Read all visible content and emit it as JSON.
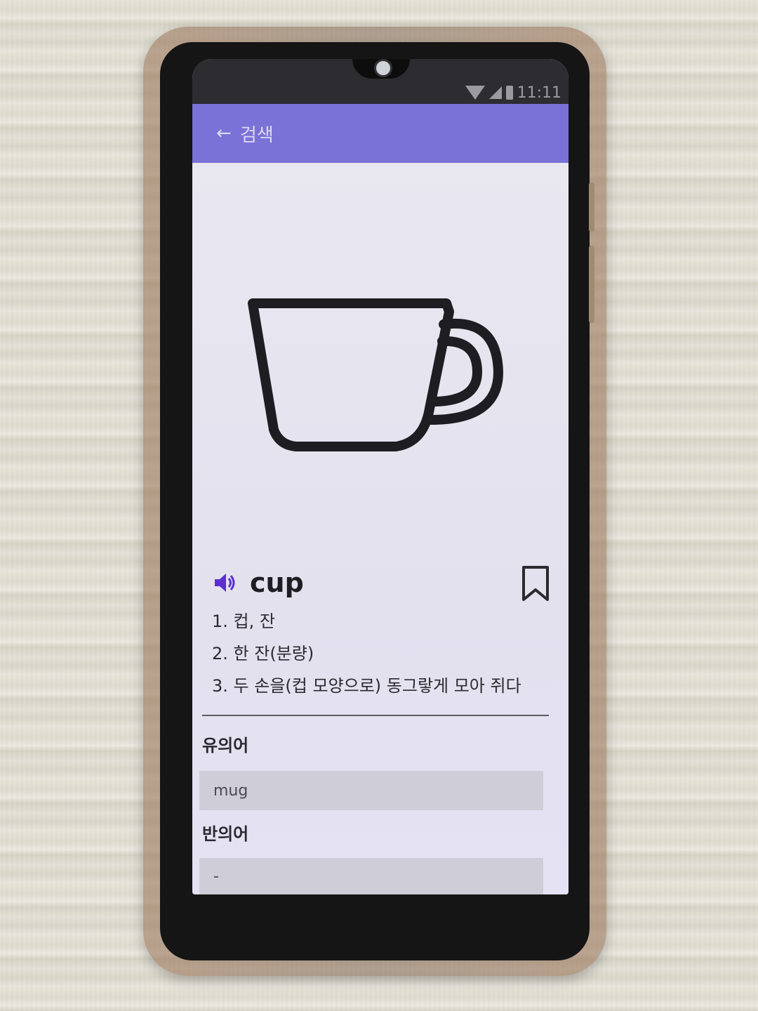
{
  "status_bar": {
    "time": "11:11",
    "icons": [
      "wifi-icon",
      "signal-icon",
      "battery-icon"
    ]
  },
  "app_bar": {
    "back_icon": "back-arrow-icon",
    "title": "검색",
    "color": "#7a72d6"
  },
  "illustration": {
    "icon": "cup-icon"
  },
  "entry": {
    "speaker_icon": "speaker-icon",
    "word": "cup",
    "bookmark_icon": "bookmark-icon",
    "meanings": [
      "1. 컵, 잔",
      "2. 한 잔(분량)",
      "3. 두 손을(컵 모양으로) 동그랗게 모아 쥐다"
    ]
  },
  "synonyms": {
    "title": "유의어",
    "value": "mug"
  },
  "antonyms": {
    "title": "반의어",
    "value": "-"
  }
}
